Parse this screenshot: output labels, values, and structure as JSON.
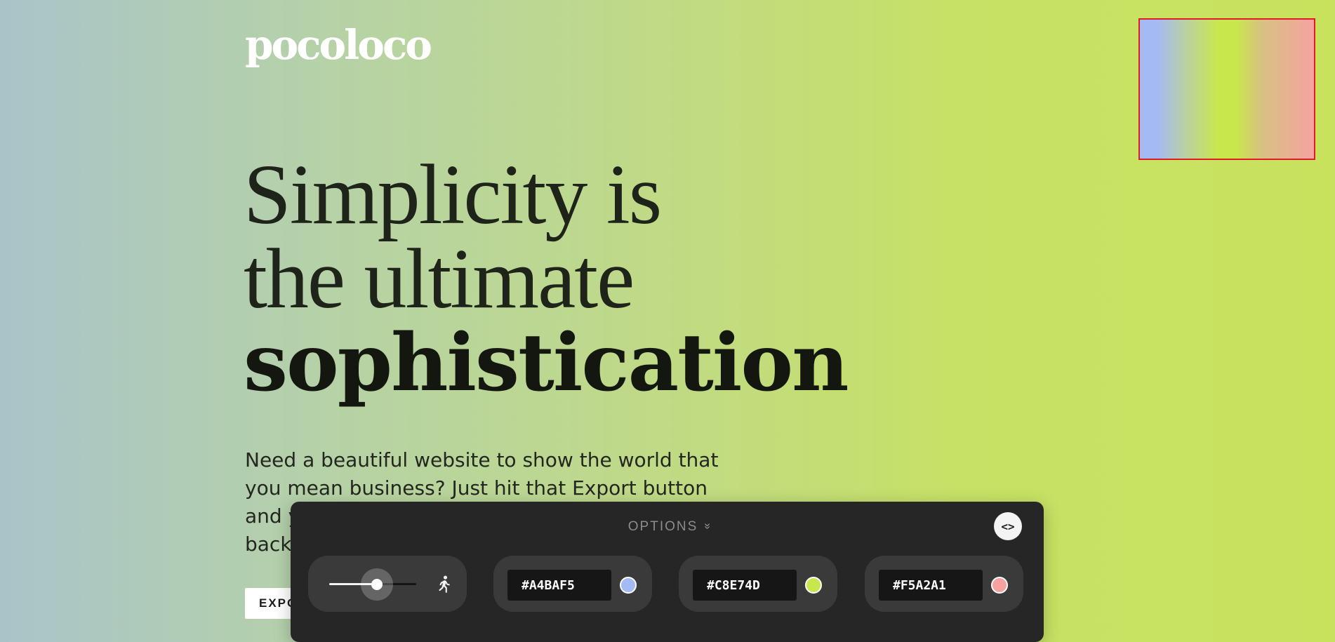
{
  "brand": {
    "logo_text": "pocoloco"
  },
  "hero": {
    "headline_line1": "Simplicity is",
    "headline_line2": "the ultimate",
    "headline_line3": "sophistication",
    "intro": "Need a beautiful website to show the world that you mean business? Just hit that Export button and y… back…",
    "intro_visible_line1": "Need a beautiful website to show the world that",
    "intro_visible_line2": "you mean business? Just hit that Export button",
    "intro_visible_line3": "and y",
    "intro_visible_line4": "back",
    "export_label": "EXPO"
  },
  "preview": {
    "colors": [
      "#A4BAF5",
      "#C8E74D",
      "#F5A2A1"
    ],
    "border_color": "#e01b24"
  },
  "panel": {
    "options_label": "OPTIONS",
    "code_toggle_label": "<>",
    "speed": {
      "value_fraction": 0.55,
      "icon": "running-person-icon"
    },
    "colors": [
      {
        "hex": "#A4BAF5",
        "swatch": "#A4BAF5"
      },
      {
        "hex": "#C8E74D",
        "swatch": "#C8E74D"
      },
      {
        "hex": "#F5A2A1",
        "swatch": "#F5A2A1"
      }
    ]
  }
}
